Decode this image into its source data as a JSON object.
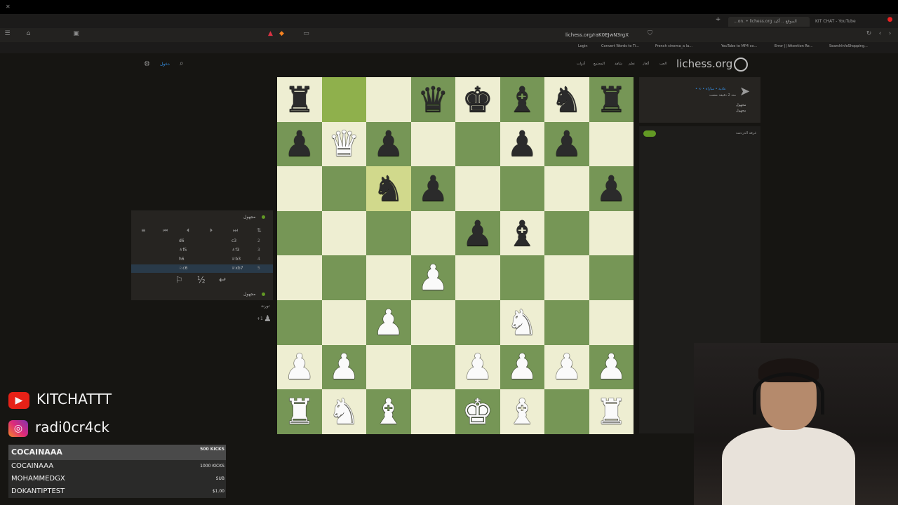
{
  "browser": {
    "tabs": [
      {
        "label": "...on. • lichess.org الموقع .. أكيد",
        "active": true
      },
      {
        "label": "KIT CHAT - YouTube",
        "active": false
      }
    ],
    "url": "lichess.org/raK0EJwN3rgX",
    "bookmarks": [
      "Login",
      "Convert Words to Ti...",
      "French cinema_a la...",
      "YouTube to MP4 co...",
      "Error || Attention Re...",
      "SearchInfoShopping..."
    ]
  },
  "lichess": {
    "logo": "lichess.org",
    "nav": [
      "العب",
      "ألغاز",
      "تعلم",
      "شاهد",
      "المجتمع",
      "أدوات"
    ],
    "header_left_label": "دخول"
  },
  "board": {
    "ranks": [
      [
        "bR",
        "",
        "",
        "bQ",
        "bK",
        "bB",
        "bN",
        "bR"
      ],
      [
        "bP",
        "wQ",
        "bP",
        "",
        "",
        "bP",
        "bP",
        ""
      ],
      [
        "",
        "",
        "bN",
        "bP",
        "",
        "",
        "",
        "bP"
      ],
      [
        "",
        "",
        "",
        "",
        "bP",
        "bB",
        "",
        ""
      ],
      [
        "",
        "",
        "",
        "wP",
        "",
        "",
        "",
        ""
      ],
      [
        "",
        "",
        "wP",
        "",
        "",
        "wN",
        "",
        ""
      ],
      [
        "wP",
        "wP",
        "",
        "",
        "wP",
        "wP",
        "wP",
        "wP"
      ],
      [
        "wR",
        "wN",
        "wB",
        "",
        "wK",
        "wB",
        "",
        "wR"
      ]
    ],
    "highlight": [
      [
        0,
        1
      ],
      [
        2,
        2
      ]
    ]
  },
  "move_panel": {
    "top_player": "مجهول",
    "bottom_player": "مجهول",
    "moves": [
      {
        "n": "2",
        "w": "c3",
        "b": "d6"
      },
      {
        "n": "3",
        "w": "♗f3",
        "b": "♗f5"
      },
      {
        "n": "4",
        "w": "♕b3",
        "b": "h6"
      },
      {
        "n": "5",
        "w": "♕xb7",
        "b": "♘c6",
        "selected": true
      }
    ],
    "actions": [
      "⚐",
      "½",
      "↩"
    ],
    "below_label": "تورنة",
    "plus_label": "+1"
  },
  "right_panel": {
    "game_info": "• ∞ • عادية • مباراة",
    "time": "منذ 2 دقيقة مضت",
    "players": [
      "مجهول",
      "مجهول"
    ],
    "chat_label": "غرفة الدردشة"
  },
  "overlay": {
    "youtube": "KITCHATTT",
    "instagram": "radi0cr4ck",
    "kicks": [
      {
        "name": "COCAINAAA",
        "amount": "500 KICKS",
        "top": true
      },
      {
        "name": "COCAINAAA",
        "amount": "1000 KICKS"
      },
      {
        "name": "MOHAMMEDGX",
        "amount": "SUB"
      },
      {
        "name": "DOKANTIPTEST",
        "amount": "$1.00"
      }
    ]
  }
}
